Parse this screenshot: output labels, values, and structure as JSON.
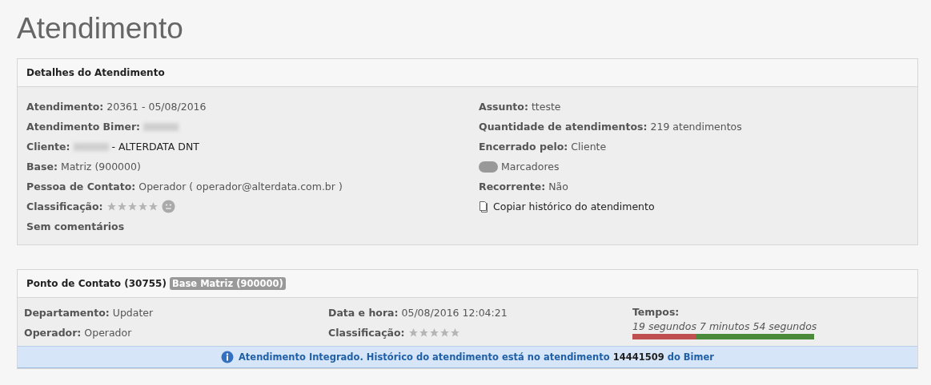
{
  "page_title": "Atendimento",
  "details": {
    "title": "Detalhes do Atendimento",
    "left": [
      {
        "kind": "field",
        "label": "Atendimento:",
        "value": "20361 - 05/08/2016"
      },
      {
        "kind": "redacted",
        "label": "Atendimento Bimer:"
      },
      {
        "kind": "redacted",
        "label": "Cliente:",
        "value": "- ALTERDATA DNT"
      },
      {
        "kind": "field",
        "label": "Base:",
        "value": "Matriz (900000)"
      },
      {
        "kind": "field",
        "label": "Pessoa de Contato:",
        "value": "Operador ( operador@alterdata.com.br )"
      },
      {
        "kind": "rating",
        "label": "Classificação:",
        "stars": 0
      },
      {
        "kind": "note",
        "label": "Sem comentários"
      }
    ],
    "right": [
      {
        "kind": "field",
        "label": "Assunto:",
        "value": "tteste"
      },
      {
        "kind": "field",
        "label": "Quantidade de atendimentos:",
        "value": "219 atendimentos"
      },
      {
        "kind": "field",
        "label": "Encerrado pelo:",
        "value": "Cliente"
      },
      {
        "kind": "tag",
        "value": "Marcadores"
      },
      {
        "kind": "field",
        "label": "Recorrente:",
        "value": "Não"
      },
      {
        "kind": "link",
        "value": "Copiar histórico do atendimento"
      }
    ]
  },
  "contact": {
    "title": "Ponto de Contato (30755)",
    "badge": "Base Matriz (900000)",
    "columns": [
      [
        {
          "kind": "field",
          "label": "Departamento:",
          "value": "Updater"
        },
        {
          "kind": "field",
          "label": "Operador:",
          "value": "Operador"
        }
      ],
      [
        {
          "kind": "field",
          "label": "Data e hora:",
          "value": "05/08/2016 12:04:21"
        },
        {
          "kind": "rating",
          "label": "Classificação:",
          "stars": 0
        }
      ],
      [
        {
          "kind": "times",
          "label": "Tempos:",
          "first": "19 segundos",
          "second": "7 minutos 54 segundos",
          "level": 0.35
        }
      ]
    ],
    "info": "Atendimento Integrado. Histórico do atendimento está no atendimento **14441509** do Bimer"
  }
}
